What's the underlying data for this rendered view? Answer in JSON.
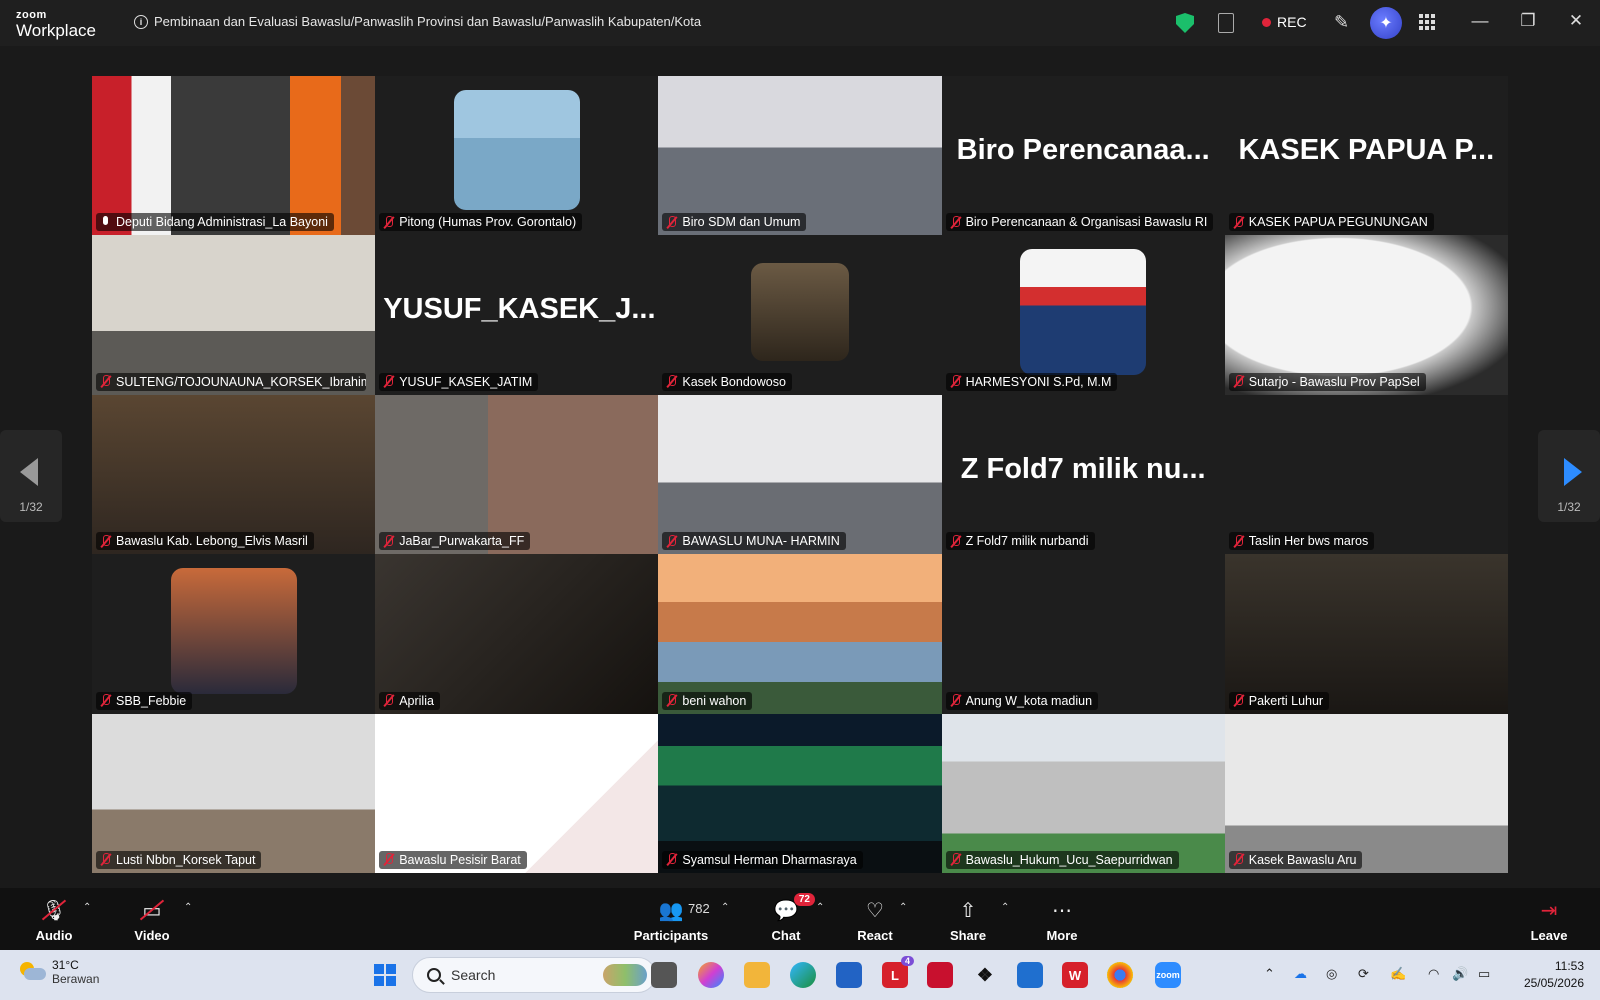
{
  "app": {
    "logo_top": "zoom",
    "logo_bottom": "Workplace"
  },
  "meeting": {
    "title": "Pembinaan dan Evaluasi Bawaslu/Panwaslih Provinsi dan Bawaslu/Panwaslih Kabupaten/Kota"
  },
  "titlebar": {
    "rec_label": "REC"
  },
  "colors": {
    "accent": "#2d8cff",
    "active_border": "#37c98a",
    "muted_red": "#e0243a",
    "secure_green": "#1bbf6b"
  },
  "pager": {
    "left_label": "1/32",
    "right_label": "1/32"
  },
  "participants": [
    {
      "name": "Deputi Bidang Administrasi_La Bayoni",
      "muted": false,
      "active": true,
      "type": "video",
      "big_text": ""
    },
    {
      "name": "Pitong (Humas Prov. Gorontalo)",
      "muted": true,
      "active": false,
      "type": "avatar",
      "big_text": ""
    },
    {
      "name": "Biro SDM dan Umum",
      "muted": true,
      "active": false,
      "type": "video",
      "big_text": ""
    },
    {
      "name": "Biro Perencanaan & Organisasi Bawaslu RI",
      "muted": true,
      "active": false,
      "type": "name",
      "big_text": "Biro Perencanaa..."
    },
    {
      "name": "KASEK PAPUA PEGUNUNGAN",
      "muted": true,
      "active": false,
      "type": "name",
      "big_text": "KASEK PAPUA P..."
    },
    {
      "name": "SULTENG/TOJOUNAUNA_KORSEK_Ibrahim U...",
      "muted": true,
      "active": false,
      "type": "video",
      "big_text": ""
    },
    {
      "name": "YUSUF_KASEK_JATIM",
      "muted": true,
      "active": false,
      "type": "name",
      "big_text": "YUSUF_KASEK_J..."
    },
    {
      "name": "Kasek Bondowoso",
      "muted": true,
      "active": false,
      "type": "avatar",
      "big_text": ""
    },
    {
      "name": "HARMESYONI S.Pd, M.M",
      "muted": true,
      "active": false,
      "type": "avatar",
      "big_text": ""
    },
    {
      "name": "Sutarjo - Bawaslu Prov PapSel",
      "muted": true,
      "active": false,
      "type": "video",
      "big_text": ""
    },
    {
      "name": "Bawaslu Kab. Lebong_Elvis Masril",
      "muted": true,
      "active": false,
      "type": "video",
      "big_text": ""
    },
    {
      "name": "JaBar_Purwakarta_FF",
      "muted": true,
      "active": false,
      "type": "video",
      "big_text": ""
    },
    {
      "name": "BAWASLU MUNA- HARMIN",
      "muted": true,
      "active": false,
      "type": "video",
      "big_text": ""
    },
    {
      "name": "Z Fold7 milik nurbandi",
      "muted": true,
      "active": false,
      "type": "name",
      "big_text": "Z Fold7 milik nu..."
    },
    {
      "name": "Taslin Her bws maros",
      "muted": true,
      "active": false,
      "type": "blank",
      "big_text": ""
    },
    {
      "name": "SBB_Febbie",
      "muted": true,
      "active": false,
      "type": "avatar",
      "big_text": ""
    },
    {
      "name": "Aprilia",
      "muted": true,
      "active": false,
      "type": "video",
      "big_text": ""
    },
    {
      "name": "beni wahon",
      "muted": true,
      "active": false,
      "type": "video",
      "big_text": ""
    },
    {
      "name": "Anung W_kota madiun",
      "muted": true,
      "active": false,
      "type": "blank",
      "big_text": ""
    },
    {
      "name": "Pakerti Luhur",
      "muted": true,
      "active": false,
      "type": "video",
      "big_text": ""
    },
    {
      "name": "Lusti Nbbn_Korsek Taput",
      "muted": true,
      "active": false,
      "type": "video",
      "big_text": ""
    },
    {
      "name": "Bawaslu Pesisir Barat",
      "muted": true,
      "active": false,
      "type": "video",
      "big_text": ""
    },
    {
      "name": "Syamsul Herman Dharmasraya",
      "muted": true,
      "active": false,
      "type": "video",
      "big_text": ""
    },
    {
      "name": "Bawaslu_Hukum_Ucu_Saepurridwan",
      "muted": true,
      "active": false,
      "type": "video",
      "big_text": ""
    },
    {
      "name": "Kasek Bawaslu Aru",
      "muted": true,
      "active": false,
      "type": "video",
      "big_text": ""
    }
  ],
  "toolbar": {
    "audio": "Audio",
    "video": "Video",
    "participants": "Participants",
    "participants_count": "782",
    "chat": "Chat",
    "chat_badge": "72",
    "react": "React",
    "share": "Share",
    "more": "More",
    "leave": "Leave"
  },
  "taskbar": {
    "temp": "31°C",
    "weather": "Berawan",
    "search_placeholder": "Search",
    "l_badge": "4",
    "time": "11:53",
    "date": "25/05/2026"
  }
}
